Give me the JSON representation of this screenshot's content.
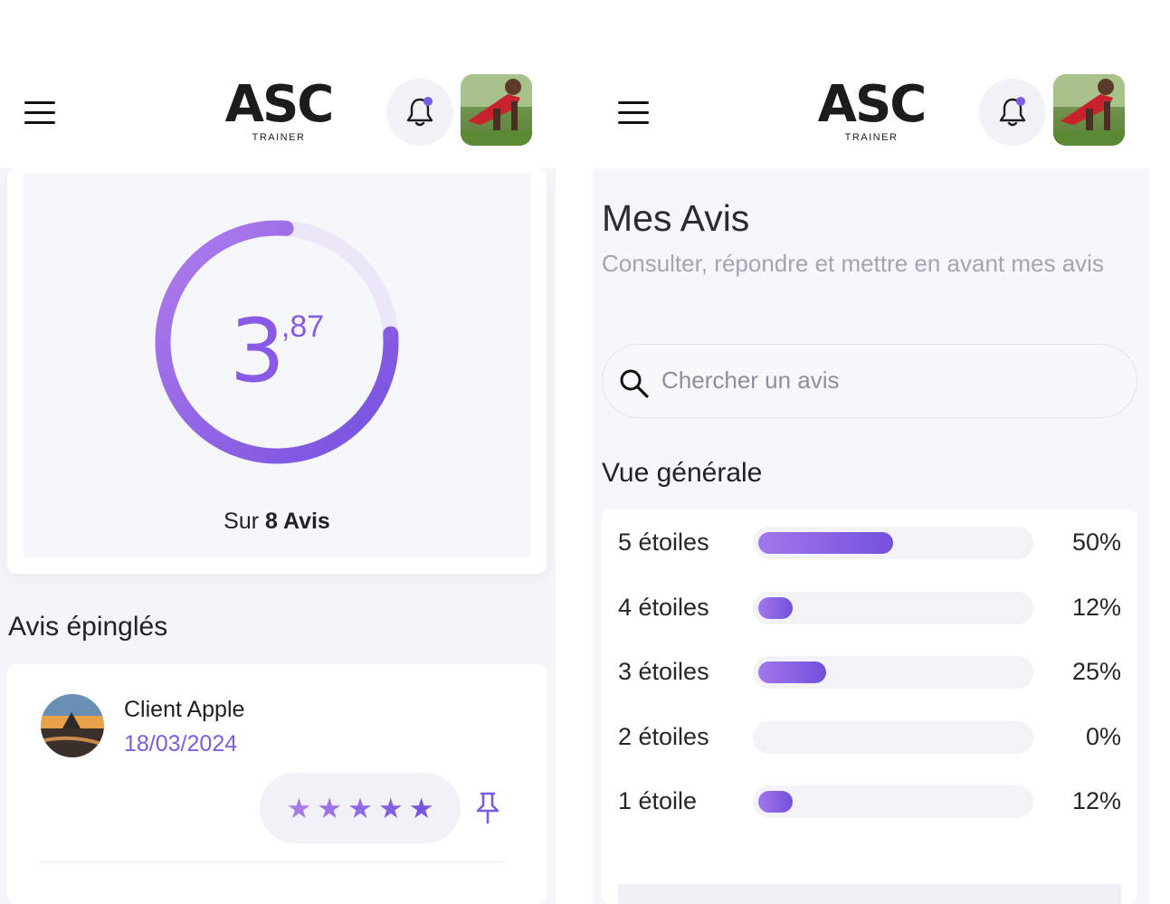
{
  "left_screen": {
    "header": {
      "logo_main": "ASC",
      "logo_sub": "TRAINER",
      "notification_dot": true
    },
    "rating": {
      "score_integer": "3",
      "score_decimal": ",87",
      "score_value": 3.87,
      "score_max": 5,
      "sur_prefix": "Sur",
      "sur_count": "8 Avis"
    },
    "pinned": {
      "title": "Avis épinglés",
      "review": {
        "client_name": "Client Apple",
        "date": "18/03/2024",
        "stars": 5
      }
    }
  },
  "right_screen": {
    "header": {
      "logo_main": "ASC",
      "logo_sub": "TRAINER",
      "notification_dot": true
    },
    "title": "Mes Avis",
    "subtitle": "Consulter, répondre et mettre en avant mes avis",
    "search": {
      "placeholder": "Chercher un avis"
    },
    "overview": {
      "title": "Vue générale",
      "rows": [
        {
          "label": "5 étoiles",
          "pct_label": "50%",
          "fraction": 0.5
        },
        {
          "label": "4 étoiles",
          "pct_label": "12%",
          "fraction": 0.12
        },
        {
          "label": "3 étoiles",
          "pct_label": "25%",
          "fraction": 0.25
        },
        {
          "label": "2 étoiles",
          "pct_label": "0%",
          "fraction": 0.0
        },
        {
          "label": "1 étoile",
          "pct_label": "12%",
          "fraction": 0.12
        }
      ]
    }
  },
  "colors": {
    "accent": "#7b5ce6",
    "accent_light": "#a277ec",
    "track": "#f3f3f7",
    "text": "#222222"
  },
  "icons": [
    "menu-icon",
    "bell-icon",
    "search-icon",
    "star-icon",
    "pin-icon"
  ]
}
